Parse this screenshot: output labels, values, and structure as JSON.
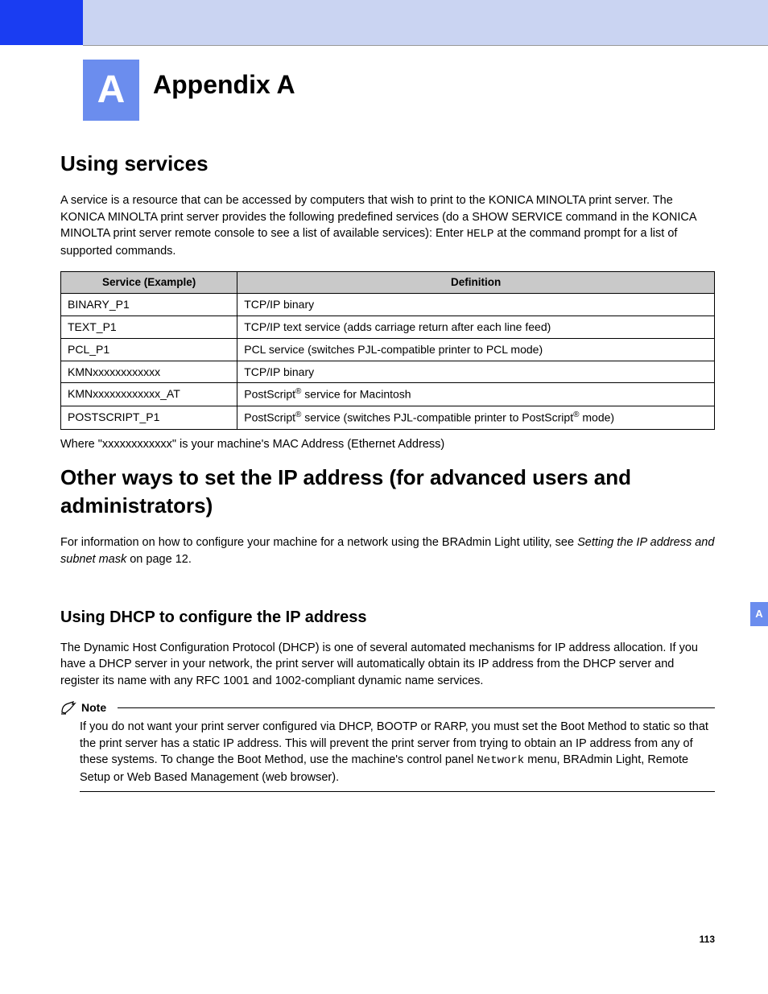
{
  "chapter": {
    "letter": "A",
    "title": "Appendix A"
  },
  "section1": {
    "heading": "Using services",
    "para_a": "A service is a resource that can be accessed by computers that wish to print to the KONICA MINOLTA print server. The KONICA MINOLTA print server provides the following predefined services (do a SHOW SERVICE command in the KONICA MINOLTA print server remote console to see a list of available services): Enter ",
    "para_code": "HELP",
    "para_b": " at the command prompt for a list of supported commands.",
    "table": {
      "h1": "Service (Example)",
      "h2": "Definition",
      "rows": [
        {
          "svc": "BINARY_P1",
          "def": "TCP/IP binary"
        },
        {
          "svc": "TEXT_P1",
          "def": "TCP/IP text service (adds carriage return after each line feed)"
        },
        {
          "svc": "PCL_P1",
          "def": "PCL service (switches PJL-compatible printer to PCL mode)"
        },
        {
          "svc": "KMNxxxxxxxxxxxx",
          "def": "TCP/IP binary"
        }
      ],
      "row5": {
        "svc": "KMNxxxxxxxxxxxx_AT",
        "a": "PostScript",
        "sup": "®",
        "b": " service for Macintosh"
      },
      "row6": {
        "svc": "POSTSCRIPT_P1",
        "a": "PostScript",
        "sup1": "®",
        "b": " service (switches PJL-compatible printer to PostScript",
        "sup2": "®",
        "c": " mode)"
      }
    },
    "footnote": "Where \"xxxxxxxxxxxx\" is your machine's MAC Address (Ethernet Address)"
  },
  "section2": {
    "heading": "Other ways to set the IP address (for advanced users and administrators)",
    "para_a": "For information on how to configure your machine for a network using the BRAdmin Light utility, see ",
    "para_italic": "Setting the IP address and subnet mask",
    "para_b": " on page 12."
  },
  "section3": {
    "heading": "Using DHCP to configure the IP address",
    "para": "The Dynamic Host Configuration Protocol (DHCP) is one of several automated mechanisms for IP address allocation. If you have a DHCP server in your network, the print server will automatically obtain its IP address from the DHCP server and register its name with any RFC 1001 and 1002-compliant dynamic name services."
  },
  "note": {
    "label": "Note",
    "body_a": "If you do not want your print server configured via DHCP, BOOTP or RARP, you must set the Boot Method to static so that the print server has a static IP address. This will prevent the print server from trying to obtain an IP address from any of these systems. To change the Boot Method, use the machine's control panel ",
    "body_code": "Network",
    "body_b": " menu, BRAdmin Light, Remote Setup or Web Based Management (web browser)."
  },
  "sideTab": "A",
  "pageNumber": "113"
}
